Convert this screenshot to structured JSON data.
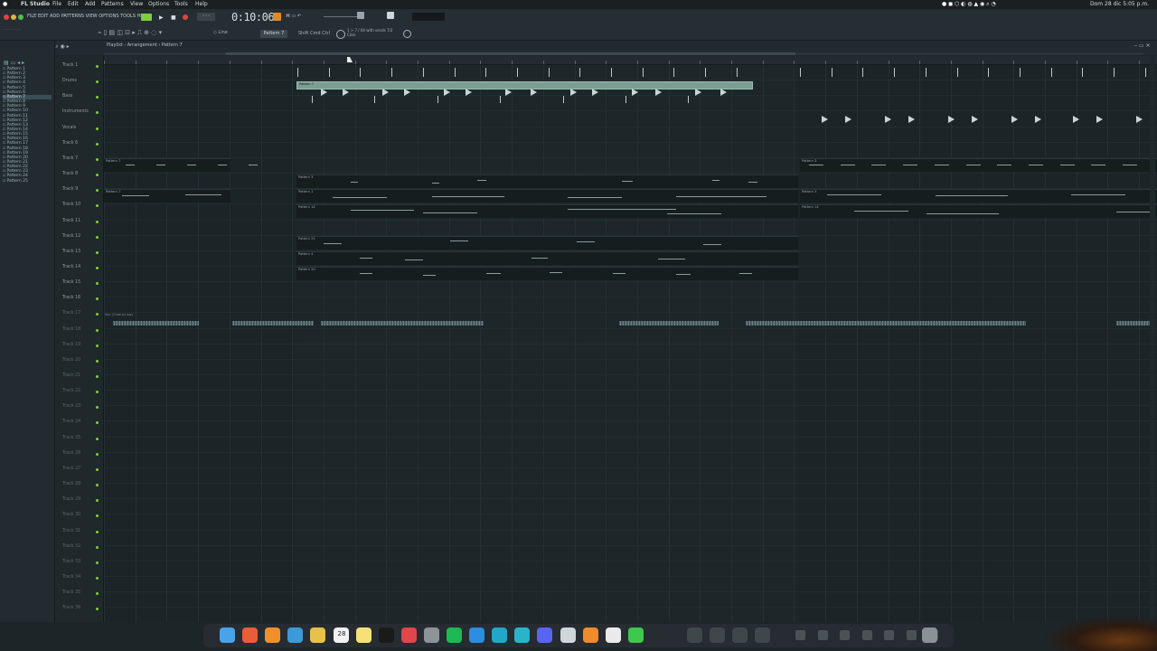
{
  "menubar": {
    "app": "FL Studio",
    "items": [
      "File",
      "Edit",
      "Add",
      "Patterns",
      "View",
      "Options",
      "Tools",
      "Help"
    ],
    "clock": "Dom 28 dic  5:05 p.m."
  },
  "toolbar": {
    "menu_strip": "FILE EDIT ADD PATTERNS VIEW OPTIONS TOOLS HELP",
    "time": "0:10:06",
    "pattern": "Pattern 7",
    "snap_items": [
      "Shift",
      "Cmd",
      "Ctrl"
    ],
    "hint": "1 > 7 / 64 with sends 7/2 Click"
  },
  "playlist": {
    "breadcrumb": "Playlist - Arrangement › Pattern 7",
    "audio_clip": "Vox (Chorus).wav"
  },
  "picker": {
    "patterns": [
      "Pattern 1",
      "Pattern 2",
      "Pattern 3",
      "Pattern 4",
      "Pattern 5",
      "Pattern 6",
      "Pattern 7",
      "Pattern 8",
      "Pattern 9",
      "Pattern 10",
      "Pattern 11",
      "Pattern 12",
      "Pattern 13",
      "Pattern 14",
      "Pattern 15",
      "Pattern 16",
      "Pattern 17",
      "Pattern 18",
      "Pattern 19",
      "Pattern 20",
      "Pattern 21",
      "Pattern 22",
      "Pattern 23",
      "Pattern 24",
      "Pattern 25"
    ],
    "selected_index": 6
  },
  "tracks": [
    "Track 1",
    "Drums",
    "Bass",
    "Instruments",
    "Vocals",
    "Track 6",
    "Track 7",
    "Track 8",
    "Track 9",
    "Track 10",
    "Track 11",
    "Track 12",
    "Track 13",
    "Track 14",
    "Track 15",
    "Track 16",
    "Track 17",
    "Track 18",
    "Track 19",
    "Track 20",
    "Track 21",
    "Track 22",
    "Track 23",
    "Track 24",
    "Track 25",
    "Track 26",
    "Track 27",
    "Track 28",
    "Track 29",
    "Track 30",
    "Track 31",
    "Track 32",
    "Track 33",
    "Track 34",
    "Track 35",
    "Track 36"
  ],
  "clips": {
    "p7": "Pattern 7",
    "p3": "Pattern 3",
    "p1": "Pattern 1",
    "p14": "Pattern 14",
    "p25": "Pattern 25",
    "p4": "Pattern 4",
    "p20": "Pattern 20",
    "kick": "Kick"
  },
  "dock": {
    "calendar_day": "28"
  },
  "colors": {
    "accent": "#7fd03a",
    "record": "#e0463a",
    "grid_bg": "#1b2427"
  }
}
